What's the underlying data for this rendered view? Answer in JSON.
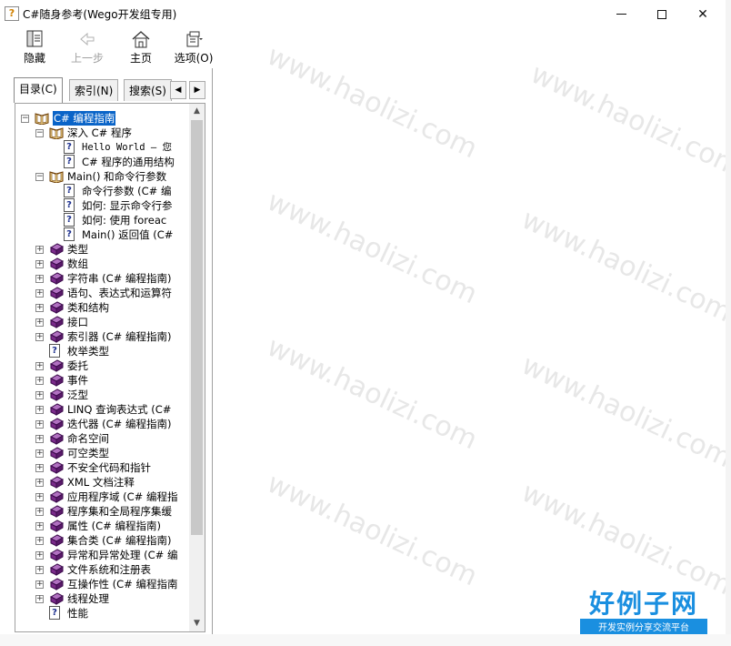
{
  "window": {
    "title": "C#随身参考(Wego开发组专用)",
    "icon": "help-question-icon"
  },
  "toolbar": {
    "buttons": [
      {
        "label": "隐藏",
        "icon": "hide-pane-icon",
        "enabled": true
      },
      {
        "label": "上一步",
        "icon": "back-arrow-icon",
        "enabled": false
      },
      {
        "label": "主页",
        "icon": "home-icon",
        "enabled": true
      },
      {
        "label": "选项(O)",
        "icon": "options-icon",
        "enabled": true
      }
    ]
  },
  "tabs": [
    {
      "label": "目录(C)",
      "active": true
    },
    {
      "label": "索引(N)",
      "active": false
    },
    {
      "label": "搜索(S)",
      "active": false
    }
  ],
  "tree": [
    {
      "text": "C# 编程指南",
      "level": 0,
      "type": "book-open",
      "expander": "minus",
      "selected": true
    },
    {
      "text": "深入 C# 程序",
      "level": 1,
      "type": "book-open",
      "expander": "minus"
    },
    {
      "text": "Hello World — 您",
      "level": 2,
      "type": "page",
      "mono": true
    },
    {
      "text": "C# 程序的通用结构",
      "level": 2,
      "type": "page"
    },
    {
      "text": "Main() 和命令行参数",
      "level": 1,
      "type": "book-open",
      "expander": "minus"
    },
    {
      "text": "命令行参数 (C# 编",
      "level": 2,
      "type": "page"
    },
    {
      "text": "如何: 显示命令行参",
      "level": 2,
      "type": "page"
    },
    {
      "text": "如何: 使用 foreac",
      "level": 2,
      "type": "page"
    },
    {
      "text": "Main() 返回值 (C#",
      "level": 2,
      "type": "page"
    },
    {
      "text": "类型",
      "level": 1,
      "type": "book",
      "expander": "plus"
    },
    {
      "text": "数组",
      "level": 1,
      "type": "book",
      "expander": "plus"
    },
    {
      "text": "字符串 (C# 编程指南)",
      "level": 1,
      "type": "book",
      "expander": "plus"
    },
    {
      "text": "语句、表达式和运算符",
      "level": 1,
      "type": "book",
      "expander": "plus"
    },
    {
      "text": "类和结构",
      "level": 1,
      "type": "book",
      "expander": "plus"
    },
    {
      "text": "接口",
      "level": 1,
      "type": "book",
      "expander": "plus"
    },
    {
      "text": "索引器 (C# 编程指南)",
      "level": 1,
      "type": "book",
      "expander": "plus"
    },
    {
      "text": "枚举类型",
      "level": 1,
      "type": "page"
    },
    {
      "text": "委托",
      "level": 1,
      "type": "book",
      "expander": "plus"
    },
    {
      "text": "事件",
      "level": 1,
      "type": "book",
      "expander": "plus"
    },
    {
      "text": "泛型",
      "level": 1,
      "type": "book",
      "expander": "plus"
    },
    {
      "text": "LINQ 查询表达式 (C#",
      "level": 1,
      "type": "book",
      "expander": "plus"
    },
    {
      "text": "迭代器 (C# 编程指南)",
      "level": 1,
      "type": "book",
      "expander": "plus"
    },
    {
      "text": "命名空间",
      "level": 1,
      "type": "book",
      "expander": "plus"
    },
    {
      "text": "可空类型",
      "level": 1,
      "type": "book",
      "expander": "plus"
    },
    {
      "text": "不安全代码和指针",
      "level": 1,
      "type": "book",
      "expander": "plus"
    },
    {
      "text": "XML 文档注释",
      "level": 1,
      "type": "book",
      "expander": "plus"
    },
    {
      "text": "应用程序域 (C# 编程指",
      "level": 1,
      "type": "book",
      "expander": "plus"
    },
    {
      "text": "程序集和全局程序集缓",
      "level": 1,
      "type": "book",
      "expander": "plus"
    },
    {
      "text": "属性 (C# 编程指南)",
      "level": 1,
      "type": "book",
      "expander": "plus"
    },
    {
      "text": "集合类 (C# 编程指南)",
      "level": 1,
      "type": "book",
      "expander": "plus"
    },
    {
      "text": "异常和异常处理 (C# 编",
      "level": 1,
      "type": "book",
      "expander": "plus"
    },
    {
      "text": "文件系统和注册表",
      "level": 1,
      "type": "book",
      "expander": "plus"
    },
    {
      "text": "互操作性 (C# 编程指南",
      "level": 1,
      "type": "book",
      "expander": "plus"
    },
    {
      "text": "线程处理",
      "level": 1,
      "type": "book",
      "expander": "plus"
    },
    {
      "text": "性能",
      "level": 1,
      "type": "page"
    }
  ],
  "watermark": "www.haolizi.com",
  "brand": {
    "name": "好例子网",
    "slogan": "开发实例分享交流平台"
  },
  "colors": {
    "selection": "#0a64c8",
    "book": "#7a2a8a",
    "brand": "#1a8fe0"
  }
}
